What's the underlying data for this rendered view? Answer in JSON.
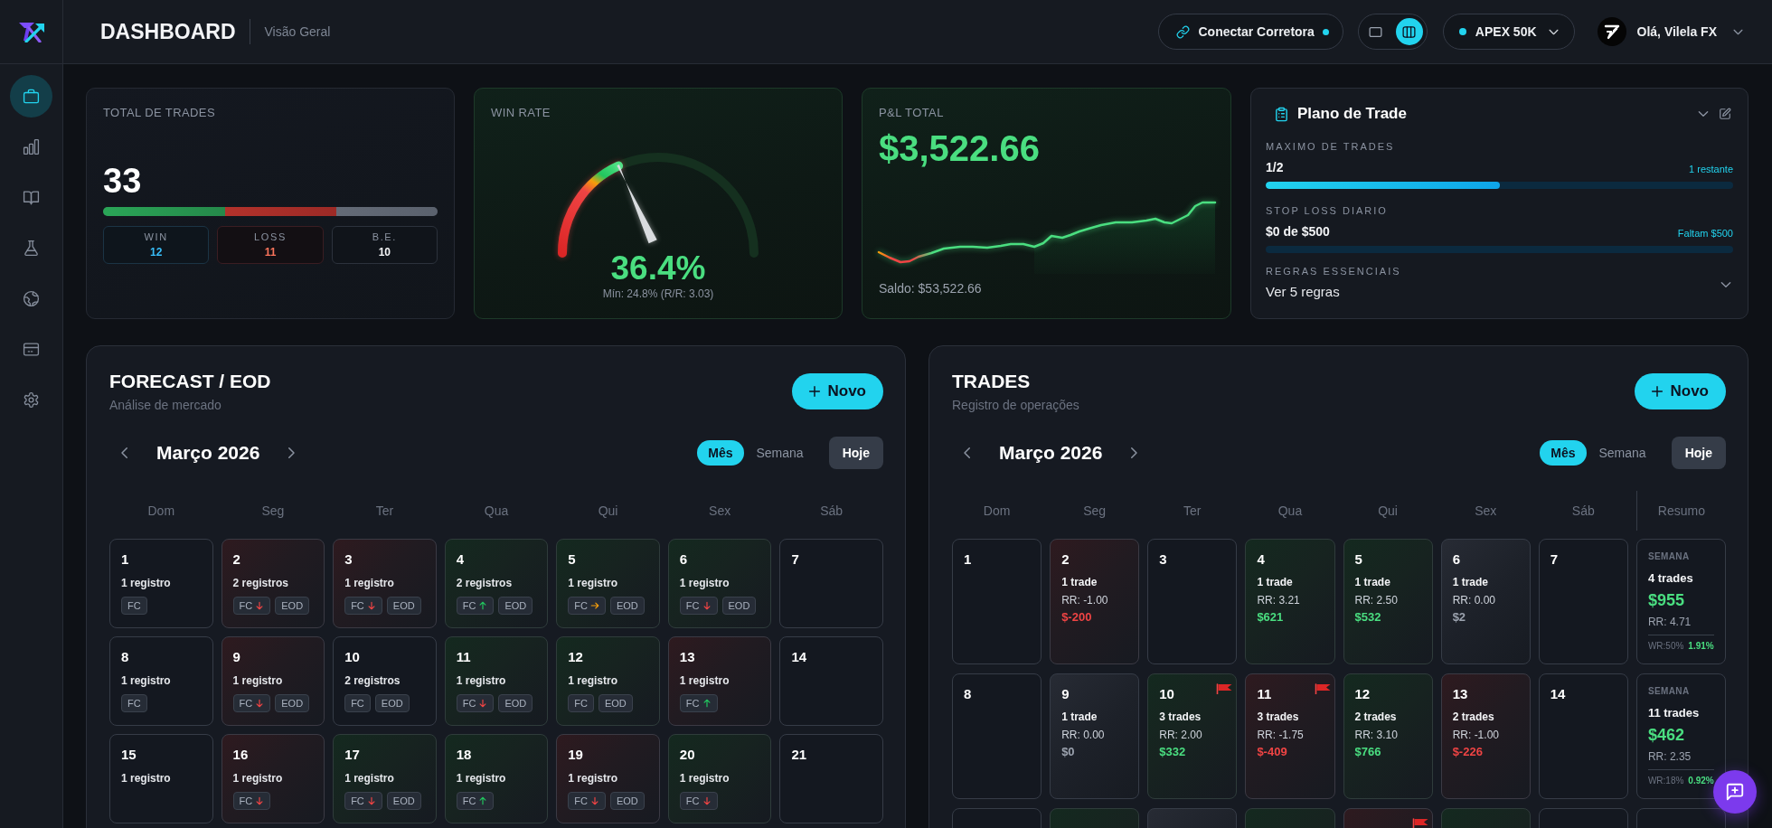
{
  "sidebar": {
    "items": [
      {
        "selected": true
      },
      {
        "selected": false
      },
      {
        "selected": false
      },
      {
        "selected": false
      },
      {
        "selected": false
      },
      {
        "selected": false
      },
      {
        "selected": false
      }
    ]
  },
  "header": {
    "title": "DASHBOARD",
    "subtitle": "Visão Geral",
    "connect_button": {
      "label": "Conectar Corretora"
    },
    "view_toggle": [
      {
        "selected": false
      },
      {
        "selected": true
      }
    ],
    "account": {
      "label": "APEX 50K"
    },
    "user": {
      "greeting": "Olá, Vilela FX"
    }
  },
  "summary_cards": {
    "total_trades": {
      "label": "TOTAL DE TRADES",
      "value": "33",
      "breakdown": [
        {
          "kind": "win",
          "label": "WIN",
          "value": "12"
        },
        {
          "kind": "loss",
          "label": "LOSS",
          "value": "11"
        },
        {
          "kind": "breakeven",
          "label": "B.E.",
          "value": "10"
        }
      ]
    },
    "win_rate": {
      "label": "WIN RATE",
      "value": "36.4%",
      "note": "Mín: 24.8% (R/R: 3.03)"
    },
    "pnl_total": {
      "label": "P&L TOTAL",
      "value": "$3,522.66",
      "balance": "Saldo: $53,522.66"
    },
    "trade_plan": {
      "title": "Plano de Trade",
      "limits": [
        {
          "label": "MAXIMO DE TRADES",
          "value": "1/2",
          "note": "1 restante",
          "level": 0.5
        },
        {
          "label": "STOP LOSS DIARIO",
          "value": "$0 de $500",
          "note": "Faltam $500",
          "level": 0
        }
      ],
      "rules": {
        "label": "REGRAS ESSENCIAIS",
        "link": "Ver 5 regras"
      }
    }
  },
  "forecast_calendar": {
    "title": "FORECAST / EOD",
    "subtitle": "Análise de mercado",
    "new_button": "Novo",
    "month": "Março 2026",
    "views": [
      {
        "label": "Mês",
        "selected": true
      },
      {
        "label": "Semana",
        "selected": false
      }
    ],
    "today_button": "Hoje",
    "weekdays": [
      "Dom",
      "Seg",
      "Ter",
      "Qua",
      "Qui",
      "Sex",
      "Sáb"
    ],
    "weeks": [
      [
        {
          "day": "1",
          "kind": "plain",
          "entries": "1 registro",
          "tags": [
            {
              "label": "FC",
              "kind": "plain"
            }
          ]
        },
        {
          "day": "2",
          "kind": "loss",
          "entries": "2 registros",
          "tags": [
            {
              "label": "FC",
              "kind": "down"
            },
            {
              "label": "EOD",
              "kind": "plain"
            }
          ]
        },
        {
          "day": "3",
          "kind": "loss",
          "entries": "1 registro",
          "tags": [
            {
              "label": "FC",
              "kind": "down"
            },
            {
              "label": "EOD",
              "kind": "plain"
            }
          ]
        },
        {
          "day": "4",
          "kind": "win",
          "entries": "2 registros",
          "tags": [
            {
              "label": "FC",
              "kind": "up"
            },
            {
              "label": "EOD",
              "kind": "plain"
            }
          ]
        },
        {
          "day": "5",
          "kind": "win",
          "entries": "1 registro",
          "tags": [
            {
              "label": "FC",
              "kind": "flat"
            },
            {
              "label": "EOD",
              "kind": "plain"
            }
          ]
        },
        {
          "day": "6",
          "kind": "win",
          "entries": "1 registro",
          "tags": [
            {
              "label": "FC",
              "kind": "down"
            },
            {
              "label": "EOD",
              "kind": "plain"
            }
          ]
        },
        {
          "day": "7",
          "kind": "plain"
        }
      ],
      [
        {
          "day": "8",
          "kind": "plain",
          "entries": "1 registro",
          "tags": [
            {
              "label": "FC",
              "kind": "plain"
            }
          ]
        },
        {
          "day": "9",
          "kind": "loss",
          "entries": "1 registro",
          "tags": [
            {
              "label": "FC",
              "kind": "down"
            },
            {
              "label": "EOD",
              "kind": "plain"
            }
          ]
        },
        {
          "day": "10",
          "kind": "plain",
          "entries": "2 registros",
          "tags": [
            {
              "label": "FC",
              "kind": "plain"
            },
            {
              "label": "EOD",
              "kind": "plain"
            }
          ]
        },
        {
          "day": "11",
          "kind": "win",
          "entries": "1 registro",
          "tags": [
            {
              "label": "FC",
              "kind": "down"
            },
            {
              "label": "EOD",
              "kind": "plain"
            }
          ]
        },
        {
          "day": "12",
          "kind": "win",
          "entries": "1 registro",
          "tags": [
            {
              "label": "FC",
              "kind": "plain"
            },
            {
              "label": "EOD",
              "kind": "plain"
            }
          ]
        },
        {
          "day": "13",
          "kind": "loss",
          "entries": "1 registro",
          "tags": [
            {
              "label": "FC",
              "kind": "up"
            }
          ]
        },
        {
          "day": "14",
          "kind": "plain"
        }
      ],
      [
        {
          "day": "15",
          "kind": "plain",
          "entries": "1 registro"
        },
        {
          "day": "16",
          "kind": "loss",
          "entries": "1 registro",
          "tags": [
            {
              "label": "FC",
              "kind": "down"
            }
          ]
        },
        {
          "day": "17",
          "kind": "win",
          "entries": "1 registro",
          "tags": [
            {
              "label": "FC",
              "kind": "down"
            },
            {
              "label": "EOD",
              "kind": "plain"
            }
          ]
        },
        {
          "day": "18",
          "kind": "win",
          "entries": "1 registro",
          "tags": [
            {
              "label": "FC",
              "kind": "up"
            }
          ]
        },
        {
          "day": "19",
          "kind": "loss",
          "entries": "1 registro",
          "tags": [
            {
              "label": "FC",
              "kind": "down"
            },
            {
              "label": "EOD",
              "kind": "plain"
            }
          ]
        },
        {
          "day": "20",
          "kind": "win",
          "entries": "1 registro",
          "tags": [
            {
              "label": "FC",
              "kind": "down"
            }
          ]
        },
        {
          "day": "21",
          "kind": "plain"
        }
      ]
    ]
  },
  "trades_calendar": {
    "title": "TRADES",
    "subtitle": "Registro de operações",
    "new_button": "Novo",
    "month": "Março 2026",
    "views": [
      {
        "label": "Mês",
        "selected": true
      },
      {
        "label": "Semana",
        "selected": false
      }
    ],
    "today_button": "Hoje",
    "weekdays": [
      "Dom",
      "Seg",
      "Ter",
      "Qua",
      "Qui",
      "Sex",
      "Sáb"
    ],
    "summary_header": "Resumo",
    "weeks": [
      {
        "days": [
          {
            "day": "1",
            "kind": "plain",
            "flagged": false
          },
          {
            "day": "2",
            "kind": "loss",
            "flagged": false,
            "count": "1 trade",
            "rr": "RR: -1.00",
            "pnl": "$-200"
          },
          {
            "day": "3",
            "kind": "plain",
            "flagged": false
          },
          {
            "day": "4",
            "kind": "win",
            "flagged": false,
            "count": "1 trade",
            "rr": "RR: 3.21",
            "pnl": "$621"
          },
          {
            "day": "5",
            "kind": "win",
            "flagged": false,
            "count": "1 trade",
            "rr": "RR: 2.50",
            "pnl": "$532"
          },
          {
            "day": "6",
            "kind": "even",
            "flagged": false,
            "count": "1 trade",
            "rr": "RR: 0.00",
            "pnl": "$2"
          },
          {
            "day": "7",
            "kind": "plain",
            "flagged": false
          }
        ],
        "summary": {
          "label": "SEMANA",
          "kind": "win",
          "count": "4 trades",
          "pnl": "$955",
          "rr": "RR: 4.71",
          "win_rate": "WR:50%",
          "return": "1.91%"
        }
      },
      {
        "days": [
          {
            "day": "8",
            "kind": "plain",
            "flagged": false
          },
          {
            "day": "9",
            "kind": "even",
            "flagged": false,
            "count": "1 trade",
            "rr": "RR: 0.00",
            "pnl": "$0"
          },
          {
            "day": "10",
            "kind": "win",
            "flagged": true,
            "count": "3 trades",
            "rr": "RR: 2.00",
            "pnl": "$332"
          },
          {
            "day": "11",
            "kind": "loss",
            "flagged": true,
            "count": "3 trades",
            "rr": "RR: -1.75",
            "pnl": "$-409"
          },
          {
            "day": "12",
            "kind": "win",
            "flagged": false,
            "count": "2 trades",
            "rr": "RR: 3.10",
            "pnl": "$766"
          },
          {
            "day": "13",
            "kind": "loss",
            "flagged": false,
            "count": "2 trades",
            "rr": "RR: -1.00",
            "pnl": "$-226"
          },
          {
            "day": "14",
            "kind": "plain",
            "flagged": false
          }
        ],
        "summary": {
          "label": "SEMANA",
          "kind": "win",
          "count": "11 trades",
          "pnl": "$462",
          "rr": "RR: 2.35",
          "win_rate": "WR:18%",
          "return": "0.92%"
        }
      },
      {
        "days": [
          {
            "kind": "plain",
            "flagged": false
          },
          {
            "kind": "win",
            "flagged": false
          },
          {
            "kind": "even",
            "flagged": false
          },
          {
            "kind": "win",
            "flagged": false
          },
          {
            "kind": "loss",
            "flagged": true
          },
          {
            "kind": "win",
            "flagged": false
          },
          {
            "kind": "plain",
            "flagged": false
          }
        ]
      }
    ]
  }
}
